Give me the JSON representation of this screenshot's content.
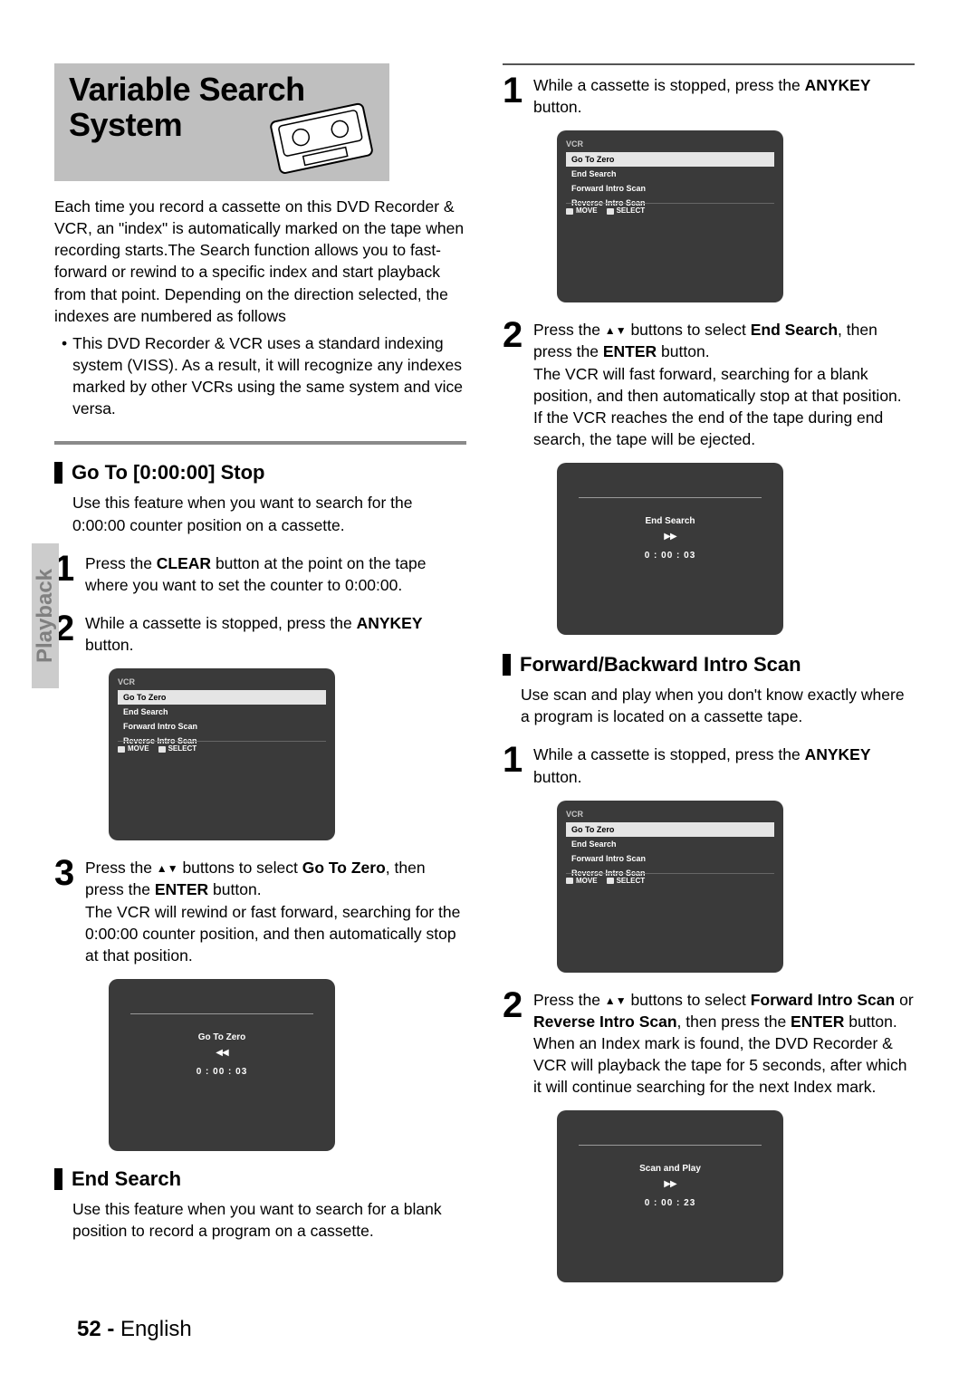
{
  "sideTab": "Playback",
  "title": {
    "line1": "Variable Search",
    "line2": "System"
  },
  "intro": "Each time you record a cassette on this DVD Recorder & VCR, an \"index\" is automatically marked on the tape when recording starts.The Search function allows you to fast-forward or rewind to a specific index and start playback from that point. Depending on the direction selected, the indexes are numbered as follows",
  "bullet": "This DVD Recorder & VCR uses a standard indexing system (VISS). As a result, it will recognize any indexes marked by other VCRs using the same system and vice versa.",
  "sections": {
    "goto": {
      "heading": "Go To [0:00:00] Stop",
      "desc": "Use this feature when you want to search for the 0:00:00 counter position on a cassette.",
      "step1": {
        "a": "Press the ",
        "b": "CLEAR",
        "c": " button at the point on the tape where you want to set the counter to 0:00:00."
      },
      "step2": {
        "a": "While a cassette is stopped, press the ",
        "b": "ANYKEY",
        "c": " button."
      },
      "step3": {
        "a": "Press the ",
        "b": " buttons to select ",
        "c": "Go To Zero",
        "d": ", then press the ",
        "e": "ENTER",
        "f": " button.",
        "tail": "The VCR will rewind or fast forward, searching for the 0:00:00 counter position, and then automatically stop at that position."
      },
      "status": {
        "label": "Go To Zero",
        "arrows": "◀◀",
        "time": "0 : 00 : 03"
      }
    },
    "end": {
      "heading": "End Search",
      "desc": "Use this feature when you want to search for a blank position to record a program on a cassette.",
      "step1": {
        "a": "While a cassette is stopped, press the ",
        "b": "ANYKEY",
        "c": " button."
      },
      "step2": {
        "a": "Press the ",
        "b": " buttons to select ",
        "c": "End Search",
        "d": ", then press the ",
        "e": "ENTER",
        "f": " button.",
        "tail": "The VCR will fast forward, searching for a blank position, and then automatically stop at that position. If the VCR reaches the end of the tape during end search, the tape will be ejected."
      },
      "status": {
        "label": "End Search",
        "arrows": "▶▶",
        "time": "0 : 00 : 03"
      }
    },
    "scan": {
      "heading": "Forward/Backward Intro Scan",
      "desc": "Use scan and play when you don't know exactly where a program is located on a cassette tape.",
      "step1": {
        "a": "While a cassette is stopped, press the ",
        "b": "ANYKEY",
        "c": " button."
      },
      "step2": {
        "a": "Press the ",
        "b": " buttons to select ",
        "c": "Forward Intro Scan",
        "d": " or ",
        "e": "Reverse Intro Scan",
        "f": ", then press the ",
        "g": "ENTER",
        "h": " button. When an Index mark is found, the DVD Recorder & VCR will playback the tape for 5 seconds, after which it will continue searching for the next Index mark."
      },
      "status": {
        "label": "Scan and Play",
        "arrows": "▶▶",
        "time": "0 : 00 : 23"
      }
    }
  },
  "osdMenu": {
    "header": "VCR",
    "items": [
      "Go To Zero",
      "End Search",
      "Forward Intro Scan",
      "Reverse Intro Scan"
    ],
    "move": "MOVE",
    "select": "SELECT"
  },
  "footer": {
    "page": "52 -",
    "lang": "English"
  }
}
